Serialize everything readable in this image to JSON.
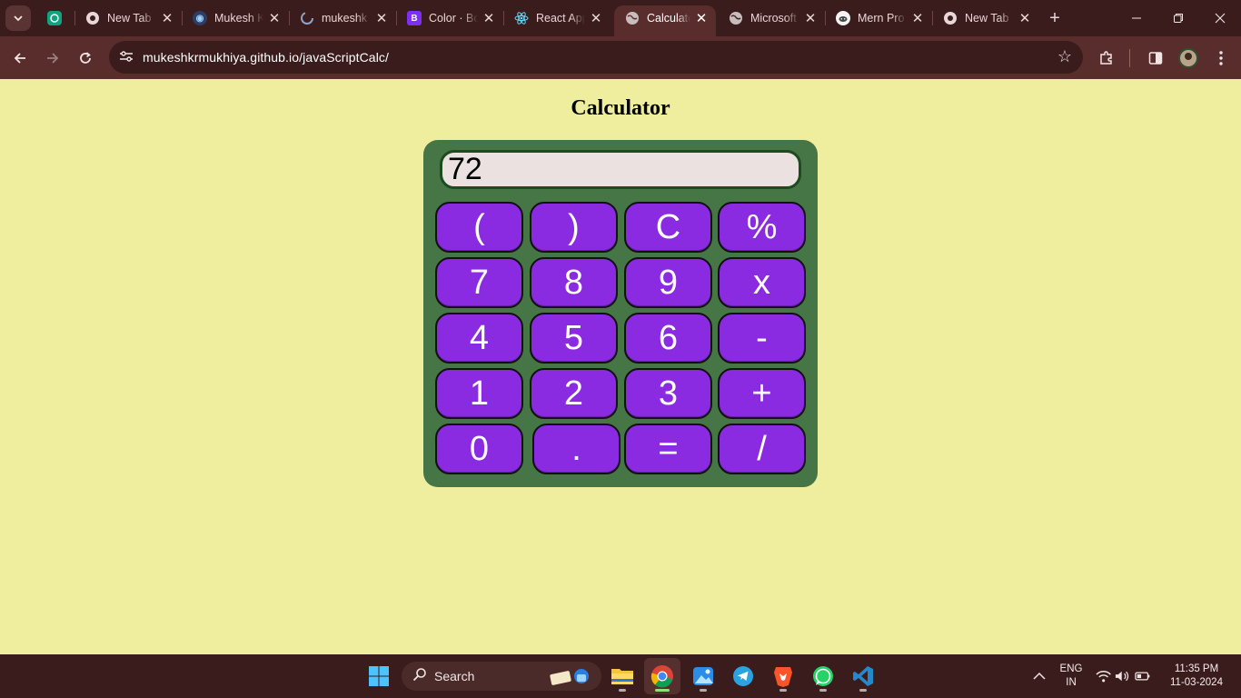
{
  "browser": {
    "tabs": [
      {
        "title": "",
        "icon": "chatgpt-icon",
        "active": false
      },
      {
        "title": "New Tab",
        "icon": "chrome-icon",
        "active": false
      },
      {
        "title": "Mukesh K",
        "icon": "portfolio-icon",
        "active": false
      },
      {
        "title": "mukeshk",
        "icon": "github-icon",
        "active": false
      },
      {
        "title": "Color · Bo",
        "icon": "bootstrap-icon",
        "active": false
      },
      {
        "title": "React App",
        "icon": "react-icon",
        "active": false
      },
      {
        "title": "Calculator",
        "icon": "globe-icon",
        "active": true
      },
      {
        "title": "Microsoft",
        "icon": "globe-icon",
        "active": false
      },
      {
        "title": "Mern Pro",
        "icon": "reddit-icon",
        "active": false
      },
      {
        "title": "New Tab",
        "icon": "chrome-icon",
        "active": false
      }
    ],
    "address": "mukeshkrmukhiya.github.io/javaScriptCalc/"
  },
  "page": {
    "title": "Calculator",
    "display_value": "72",
    "keys": [
      [
        "(",
        ")",
        "C",
        "%"
      ],
      [
        "7",
        "8",
        "9",
        "x"
      ],
      [
        "4",
        "5",
        "6",
        "-"
      ],
      [
        "1",
        "2",
        "3",
        "+"
      ],
      [
        "0",
        ".",
        "=",
        "/"
      ]
    ]
  },
  "taskbar": {
    "search_label": "Search",
    "language": "ENG",
    "region": "IN",
    "time": "11:35 PM",
    "date": "11-03-2024"
  },
  "colors": {
    "page_bg": "#eeee9e",
    "calc_bg": "#467546",
    "key_bg": "#8a2be2",
    "display_bg": "#ece1e1",
    "chrome_frame": "#3a1c1c",
    "chrome_toolbar": "#5a2d2d"
  }
}
